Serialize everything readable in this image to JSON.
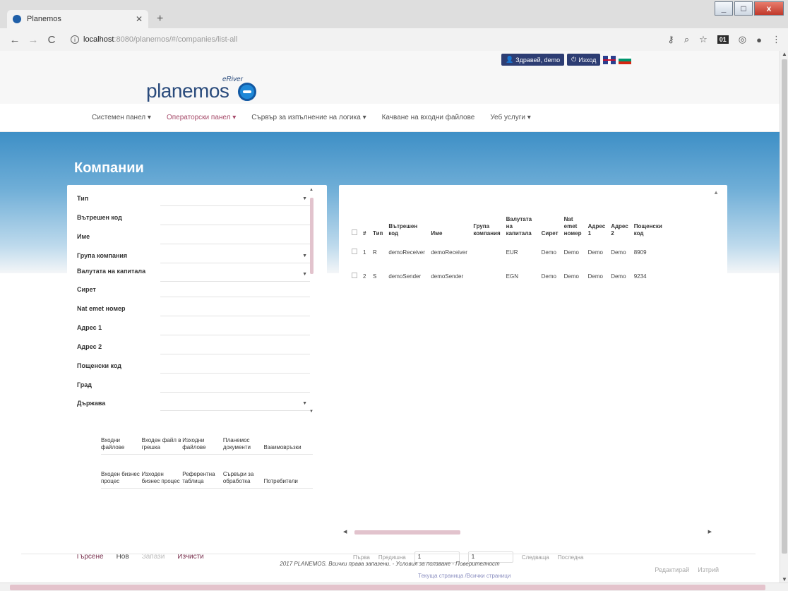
{
  "browser": {
    "tab_title": "Planemos",
    "url_host": "localhost",
    "url_rest": ":8080/planemos/#/companies/list-all",
    "win_min": "_",
    "win_max": "□",
    "win_close": "x",
    "ext_badge": "01"
  },
  "userbar": {
    "greeting": "Здравей, demo",
    "logout": "Изход"
  },
  "logo": {
    "small": "eRiver",
    "big": "planemos"
  },
  "nav": {
    "items": [
      "Системен панел ▾",
      "Операторски панел ▾",
      "Сървър за изпълнение на логика ▾",
      "Качване на входни файлове",
      "Уеб услуги ▾"
    ]
  },
  "page_title": "Компании",
  "filter": {
    "fields": [
      {
        "label": "Тип",
        "type": "select"
      },
      {
        "label": "Вътрешен код",
        "type": "text"
      },
      {
        "label": "Име",
        "type": "text"
      },
      {
        "label": "Група компания",
        "type": "select"
      },
      {
        "label": "Валутата на капитала",
        "type": "select"
      },
      {
        "label": "Сирет",
        "type": "text"
      },
      {
        "label": "Nat emet номер",
        "type": "text"
      },
      {
        "label": "Адрес 1",
        "type": "text"
      },
      {
        "label": "Адрес 2",
        "type": "text"
      },
      {
        "label": "Пощенски код",
        "type": "text"
      },
      {
        "label": "Град",
        "type": "text"
      },
      {
        "label": "Държава",
        "type": "select"
      }
    ],
    "links_row1": [
      "Входни файлове",
      "Входен файл в грешка",
      "Изходни файлове",
      "Планемос документи",
      "Взаимовръзки"
    ],
    "links_row2": [
      "Входен бизнес процес",
      "Изходен бизнес процес",
      "Референтна таблица",
      "Сървъри за обработка",
      "Потребители"
    ],
    "buttons": {
      "search": "Търсене",
      "new": "Нов",
      "save": "Запази",
      "clear": "Изчисти"
    }
  },
  "table": {
    "headers": [
      "#",
      "Тип",
      "Вътрешен код",
      "Име",
      "Група компания",
      "Валутата на капитала",
      "Сирет",
      "Nat emet номер",
      "Адрес 1",
      "Адрес 2",
      "Пощенски код"
    ],
    "rows": [
      [
        "1",
        "R",
        "demoReceiver",
        "demoReceiver",
        "",
        "EUR",
        "Demo",
        "Demo",
        "Demo",
        "Demo",
        "8909"
      ],
      [
        "2",
        "S",
        "demoSender",
        "demoSender",
        "",
        "EGN",
        "Demo",
        "Demo",
        "Demo",
        "Demo",
        "9234"
      ]
    ]
  },
  "pager": {
    "first": "Първа",
    "prev": "Предишна",
    "current": "1",
    "total": "1",
    "next": "Следваща",
    "last": "Последна",
    "info": "Текуща страница /Всички страници"
  },
  "right_buttons": {
    "edit": "Редактирай",
    "delete": "Изтрий"
  },
  "footer": "2017 PLANEMOS. Всички права запазени. - Условия за ползване - Поверителност"
}
